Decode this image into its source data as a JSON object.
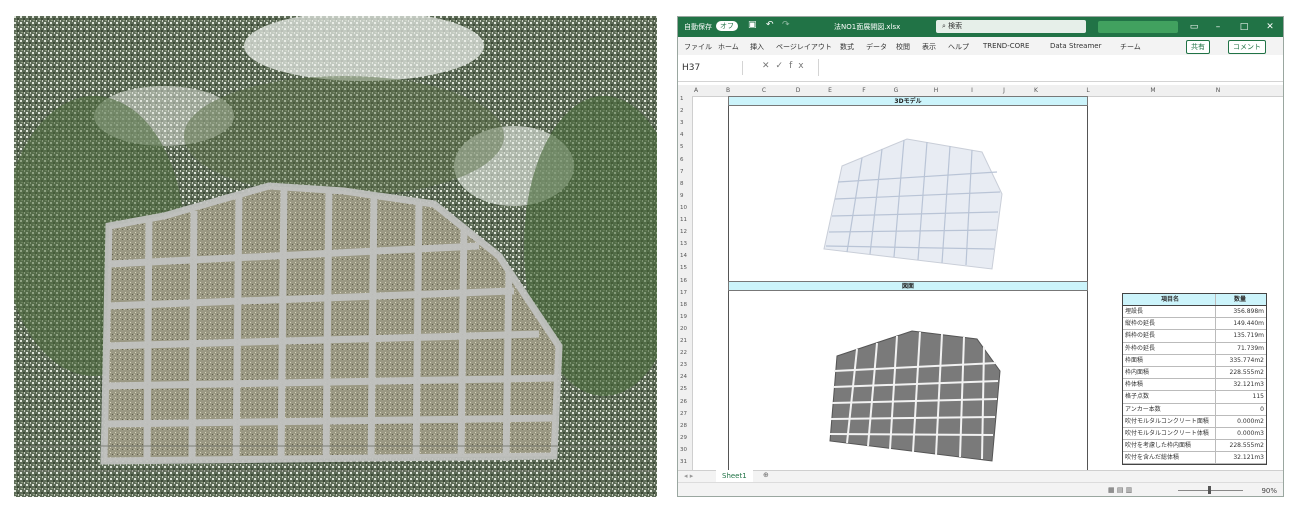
{
  "window": {
    "autosave_label": "自動保存",
    "autosave_state": "オフ",
    "filename": "法NO1面展開図.xlsx",
    "search_placeholder": "検索"
  },
  "ribbon": {
    "tabs": [
      "ファイル",
      "ホーム",
      "挿入",
      "ページレイアウト",
      "数式",
      "データ",
      "校閲",
      "表示",
      "ヘルプ",
      "TREND-CORE",
      "Data Streamer",
      "チーム"
    ],
    "share_label": "共有",
    "comment_label": "コメント"
  },
  "formula_bar": {
    "name_box": "H37",
    "fx": "fx"
  },
  "columns": [
    "A",
    "B",
    "C",
    "D",
    "E",
    "F",
    "G",
    "H",
    "I",
    "J",
    "K",
    "L",
    "M",
    "N"
  ],
  "rows": [
    "1",
    "2",
    "3",
    "4",
    "5",
    "6",
    "7",
    "8",
    "9",
    "10",
    "11",
    "12",
    "13",
    "14",
    "15",
    "16",
    "17",
    "18",
    "19",
    "20",
    "21",
    "22",
    "23",
    "24",
    "25",
    "26",
    "27",
    "28",
    "29",
    "30",
    "31"
  ],
  "sections": {
    "model_title": "3Dモデル",
    "drawing_title": "図面"
  },
  "quantity_table": {
    "header_item": "項目名",
    "header_qty": "数量",
    "rows": [
      {
        "name": "埋設長",
        "value": "356.898m"
      },
      {
        "name": "縦枠の延長",
        "value": "149.440m"
      },
      {
        "name": "斜枠の延長",
        "value": "135.719m"
      },
      {
        "name": "外枠の延長",
        "value": "71.739m"
      },
      {
        "name": "枠面積",
        "value": "335.774m2"
      },
      {
        "name": "枠内面積",
        "value": "228.555m2"
      },
      {
        "name": "枠体積",
        "value": "32.121m3"
      },
      {
        "name": "格子点数",
        "value": "115"
      },
      {
        "name": "アンカー本数",
        "value": "0"
      },
      {
        "name": "吹付モルタルコンクリート面積",
        "value": "0.000m2"
      },
      {
        "name": "吹付モルタルコンクリート体積",
        "value": "0.000m3"
      },
      {
        "name": "吹付を考慮した枠内面積",
        "value": "228.555m2"
      },
      {
        "name": "吹付を含んだ総体積",
        "value": "32.121m3"
      }
    ]
  },
  "sheet_tab": "Sheet1",
  "status": {
    "zoom": "90%"
  },
  "colors": {
    "excel_green": "#217346",
    "band_cyan": "#ccf4fb"
  }
}
